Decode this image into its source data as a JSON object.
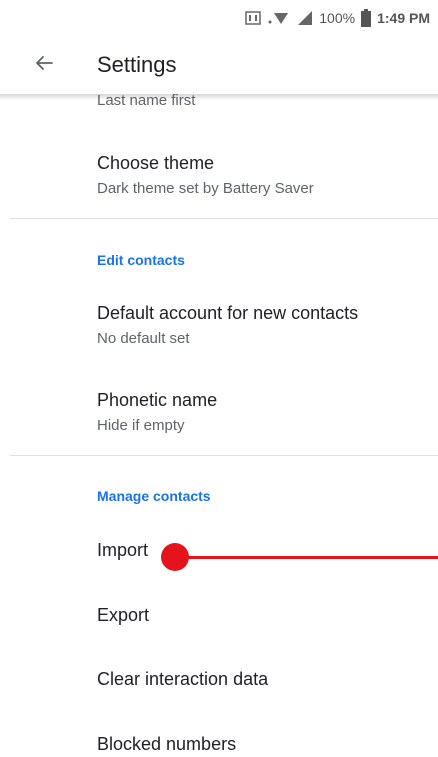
{
  "status_bar": {
    "battery": "100%",
    "time": "1:49 PM"
  },
  "app_bar": {
    "title": "Settings",
    "back_icon": "arrow-back-icon"
  },
  "items": {
    "sort_name_partial": "Last name first",
    "choose_theme": {
      "title": "Choose theme",
      "summary": "Dark theme set by Battery Saver"
    },
    "edit_contacts_header": "Edit contacts",
    "default_account": {
      "title": "Default account for new contacts",
      "summary": "No default set"
    },
    "phonetic_name": {
      "title": "Phonetic name",
      "summary": "Hide if empty"
    },
    "manage_contacts_header": "Manage contacts",
    "import": "Import",
    "export": "Export",
    "clear_interaction": "Clear interaction data",
    "blocked_numbers": "Blocked numbers"
  },
  "colors": {
    "accent": "#1a73e8",
    "annotation": "#e5141c"
  }
}
